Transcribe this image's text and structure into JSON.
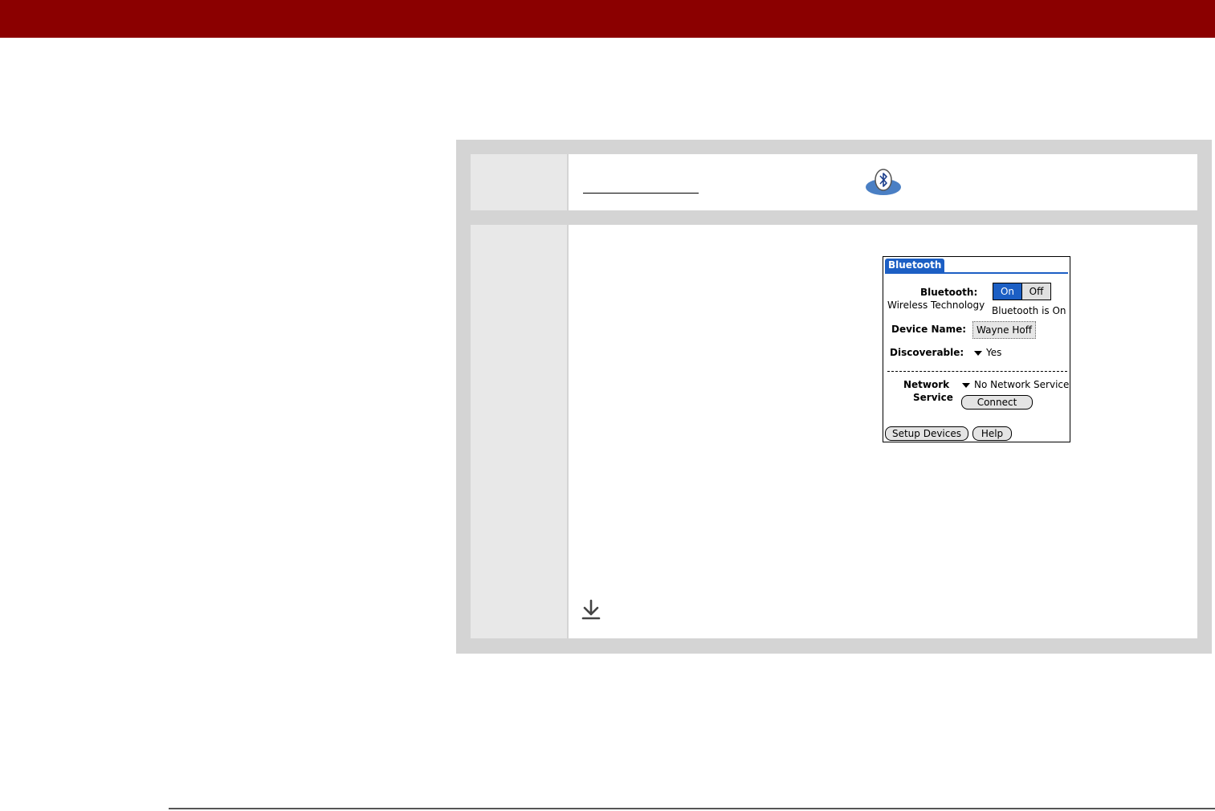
{
  "palm": {
    "tab_title": "Bluetooth",
    "bluetooth_label": "Bluetooth:",
    "wireless_label": "Wireless Technology",
    "on_label": "On",
    "off_label": "Off",
    "status_text": "Bluetooth is On",
    "device_name_label": "Device Name:",
    "device_name_value": "Wayne Hoff",
    "discoverable_label": "Discoverable:",
    "discoverable_value": "Yes",
    "network_label": "Network",
    "service_label": "Service",
    "network_value": "No Network Service",
    "connect_label": "Connect",
    "setup_devices_label": "Setup Devices",
    "help_label": "Help"
  },
  "colors": {
    "header_bar": "#8b0000",
    "palm_accent": "#1c5fc4"
  },
  "icons": [
    "bluetooth-icon",
    "download-arrow-icon"
  ]
}
